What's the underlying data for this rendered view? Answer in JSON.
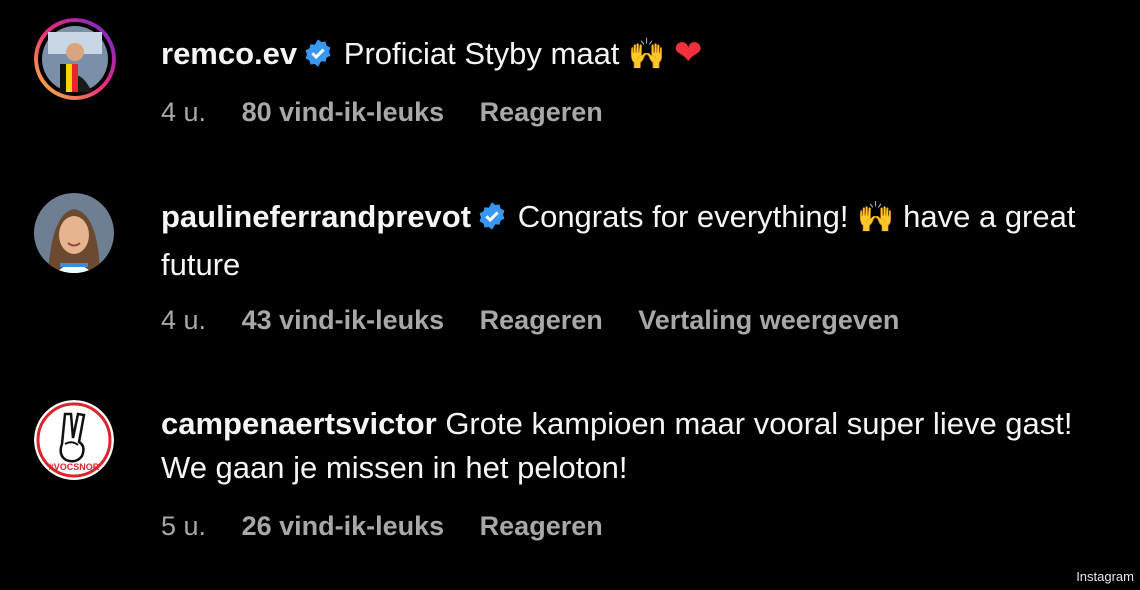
{
  "comments": [
    {
      "username": "remco.ev",
      "verified": true,
      "text": "Proficiat Styby maat",
      "emojis": [
        "🙌",
        "❤"
      ],
      "time": "4 u.",
      "likes": "80 vind-ik-leuks",
      "reply": "Reageren"
    },
    {
      "username": "paulineferrandprevot",
      "verified": true,
      "text_before": "Congrats for everything!",
      "emoji": "🙌",
      "text_after": "have a great future",
      "time": "4 u.",
      "likes": "43 vind-ik-leuks",
      "reply": "Reageren",
      "translate": "Vertaling weergeven"
    },
    {
      "username": "campenaertsvictor",
      "verified": false,
      "text": "Grote kampioen maar vooral super lieve gast! We gaan je missen in het peloton!",
      "avatar_text": "#VOCSNOR",
      "time": "5 u.",
      "likes": "26 vind-ik-leuks",
      "reply": "Reageren"
    }
  ],
  "watermark": "Instagram",
  "colors": {
    "background": "#000000",
    "text": "#f5f5f5",
    "meta": "#a8a8a8",
    "verified": "#3897f0",
    "story_ring": [
      "#f9ce34",
      "#ee2a7b",
      "#6228d7"
    ],
    "avatar3_red": "#d9262e"
  }
}
